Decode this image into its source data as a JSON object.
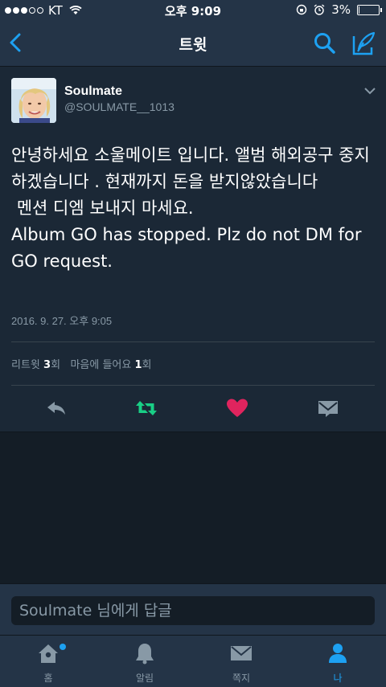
{
  "status_bar": {
    "carrier": "KT",
    "time": "오후 9:09",
    "battery": "3%",
    "battery_level": 0.03
  },
  "nav": {
    "title": "트윗"
  },
  "tweet": {
    "display_name": "Soulmate",
    "handle": "@SOULMATE__1013",
    "text": "안녕하세요 소울메이트 입니다. 앨범 해외공구 중지하겠습니다 . 현재까지 돈을 받지않았습니다\n 멘션 디엠 보내지 마세요.\nAlbum GO has stopped. Plz do not DM for GO request.",
    "timestamp": "2016. 9. 27. 오후 9:05",
    "retweets_label": "리트윗",
    "retweets_count": "3",
    "retweets_unit": "회",
    "likes_label": "마음에 들어요",
    "likes_count": "1",
    "likes_unit": "회"
  },
  "colors": {
    "accent": "#1da1f2",
    "retweet": "#19cf86",
    "like": "#e0245e"
  },
  "reply": {
    "placeholder": "Soulmate 님에게 답글"
  },
  "tabs": [
    {
      "label": "홈",
      "icon": "home-icon"
    },
    {
      "label": "알림",
      "icon": "bell-icon"
    },
    {
      "label": "쪽지",
      "icon": "envelope-icon"
    },
    {
      "label": "나",
      "icon": "person-icon"
    }
  ]
}
